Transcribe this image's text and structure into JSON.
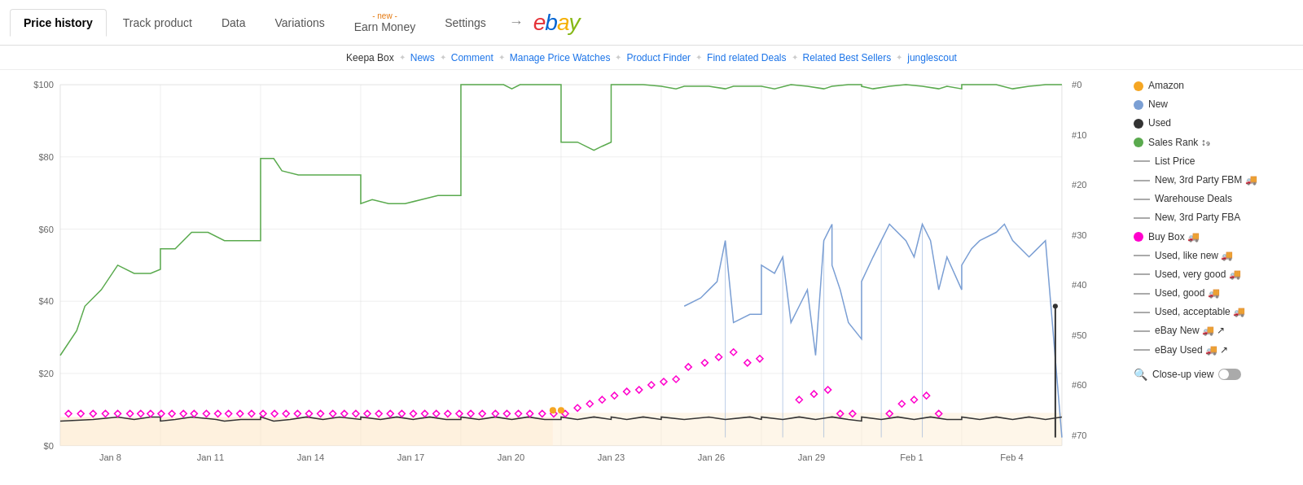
{
  "nav": {
    "tabs": [
      {
        "id": "price-history",
        "label": "Price history",
        "active": true,
        "badge": ""
      },
      {
        "id": "track-product",
        "label": "Track product",
        "active": false,
        "badge": ""
      },
      {
        "id": "data",
        "label": "Data",
        "active": false,
        "badge": ""
      },
      {
        "id": "variations",
        "label": "Variations",
        "active": false,
        "badge": ""
      },
      {
        "id": "earn-money",
        "label": "Earn Money",
        "active": false,
        "badge": "- new -"
      },
      {
        "id": "settings",
        "label": "Settings",
        "active": false,
        "badge": ""
      }
    ],
    "arrow": "→",
    "ebay_label": "ebay"
  },
  "subnav": {
    "items": [
      {
        "id": "keepa-box",
        "label": "Keepa Box",
        "clickable": false
      },
      {
        "id": "news",
        "label": "News",
        "clickable": true
      },
      {
        "id": "comment",
        "label": "Comment",
        "clickable": true
      },
      {
        "id": "manage-price-watches",
        "label": "Manage Price Watches",
        "clickable": true
      },
      {
        "id": "product-finder",
        "label": "Product Finder",
        "clickable": true
      },
      {
        "id": "find-related-deals",
        "label": "Find related Deals",
        "clickable": true
      },
      {
        "id": "related-best-sellers",
        "label": "Related Best Sellers",
        "clickable": true
      },
      {
        "id": "junglescout",
        "label": "junglescout",
        "clickable": true
      }
    ]
  },
  "chart": {
    "y_axis_labels": [
      "$100",
      "$80",
      "$60",
      "$40",
      "$20",
      "$0"
    ],
    "x_axis_labels": [
      "Jan 8",
      "Jan 11",
      "Jan 14",
      "Jan 17",
      "Jan 20",
      "Jan 23",
      "Jan 26",
      "Jan 29",
      "Feb 1",
      "Feb 4"
    ],
    "y2_axis_labels": [
      "#0",
      "#10",
      "#20",
      "#30",
      "#40",
      "#50",
      "#60",
      "#70"
    ]
  },
  "legend": {
    "items": [
      {
        "type": "dot",
        "color": "#f5a623",
        "label": "Amazon",
        "icon": ""
      },
      {
        "type": "dot",
        "color": "#7b9fd4",
        "label": "New",
        "icon": ""
      },
      {
        "type": "dot",
        "color": "#333333",
        "label": "Used",
        "icon": ""
      },
      {
        "type": "dot",
        "color": "#5aaa4e",
        "label": "Sales Rank",
        "icon": "↕₉"
      },
      {
        "type": "dash",
        "color": "#aaaaaa",
        "label": "List Price",
        "icon": ""
      },
      {
        "type": "dash",
        "color": "#aaaaaa",
        "label": "New, 3rd Party FBM",
        "icon": "🚚"
      },
      {
        "type": "dash",
        "color": "#aaaaaa",
        "label": "Warehouse Deals",
        "icon": ""
      },
      {
        "type": "dash",
        "color": "#aaaaaa",
        "label": "New, 3rd Party FBA",
        "icon": ""
      },
      {
        "type": "dot",
        "color": "#ff00cc",
        "label": "Buy Box",
        "icon": "🚚"
      },
      {
        "type": "dash",
        "color": "#aaaaaa",
        "label": "Used, like new",
        "icon": "🚚"
      },
      {
        "type": "dash",
        "color": "#aaaaaa",
        "label": "Used, very good",
        "icon": "🚚"
      },
      {
        "type": "dash",
        "color": "#aaaaaa",
        "label": "Used, good",
        "icon": "🚚"
      },
      {
        "type": "dash",
        "color": "#aaaaaa",
        "label": "Used, acceptable",
        "icon": "🚚"
      },
      {
        "type": "dash",
        "color": "#aaaaaa",
        "label": "eBay New",
        "icon": "🚚 ↗"
      },
      {
        "type": "dash",
        "color": "#aaaaaa",
        "label": "eBay Used",
        "icon": "🚚 ↗"
      }
    ],
    "close_up": {
      "icon": "🔍",
      "label": "Close-up view"
    }
  }
}
